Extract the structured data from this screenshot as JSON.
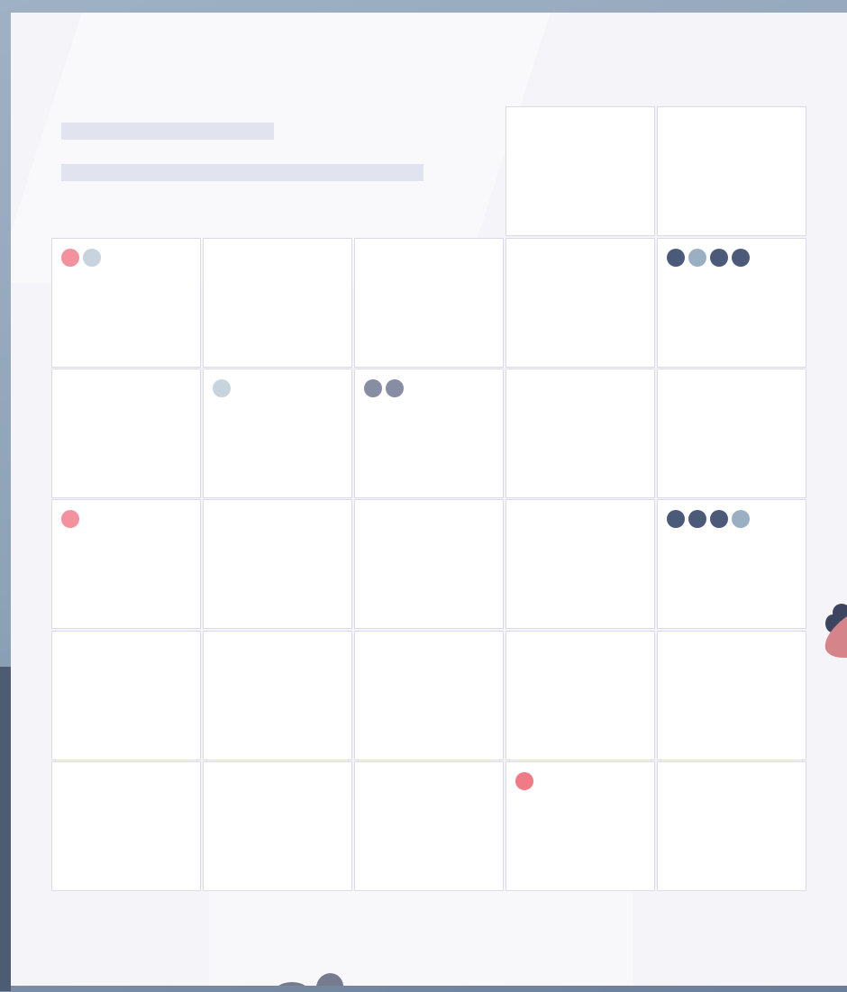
{
  "colors": {
    "pink": "#f4919e",
    "red": "#f07b87",
    "light": "#c8d4dd",
    "gray": "#878ea3",
    "navy": "#4a5a78",
    "steel": "#9aafc2"
  },
  "header_cells": [
    {
      "dots": []
    },
    {
      "dots": []
    }
  ],
  "grid": [
    [
      {
        "dots": [
          "pink",
          "light"
        ]
      },
      {
        "dots": []
      },
      {
        "dots": []
      },
      {
        "dots": []
      },
      {
        "dots": [
          "navy",
          "steel",
          "navy",
          "navy"
        ]
      }
    ],
    [
      {
        "dots": []
      },
      {
        "dots": [
          "light"
        ]
      },
      {
        "dots": [
          "gray",
          "gray"
        ]
      },
      {
        "dots": []
      },
      {
        "dots": []
      }
    ],
    [
      {
        "dots": [
          "pink"
        ]
      },
      {
        "dots": []
      },
      {
        "dots": []
      },
      {
        "dots": []
      },
      {
        "dots": [
          "navy",
          "navy",
          "navy",
          "steel"
        ]
      }
    ],
    [
      {
        "dots": []
      },
      {
        "dots": []
      },
      {
        "dots": []
      },
      {
        "dots": []
      },
      {
        "dots": []
      }
    ],
    [
      {
        "dots": []
      },
      {
        "dots": []
      },
      {
        "dots": []
      },
      {
        "dots": [
          "red"
        ]
      },
      {
        "dots": []
      }
    ]
  ]
}
